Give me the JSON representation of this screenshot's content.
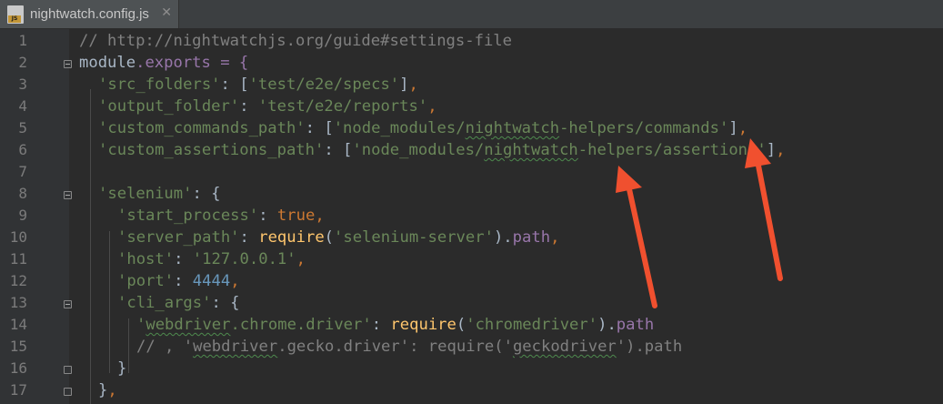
{
  "tab": {
    "icon_label": "JS",
    "filename": "nightwatch.config.js",
    "close": "✕"
  },
  "line_numbers": [
    "1",
    "2",
    "3",
    "4",
    "5",
    "6",
    "7",
    "8",
    "9",
    "10",
    "11",
    "12",
    "13",
    "14",
    "15",
    "16",
    "17"
  ],
  "code": {
    "l1": {
      "c": "// http://nightwatchjs.org/guide#settings-file"
    },
    "l2": {
      "a": "module",
      "b": ".exports = {"
    },
    "l3": {
      "a": "'src_folders'",
      "b": ": [",
      "c": "'test/e2e/specs'",
      "d": "]",
      "e": ","
    },
    "l4": {
      "a": "'output_folder'",
      "b": ": ",
      "c": "'test/e2e/reports'",
      "d": ","
    },
    "l5": {
      "a": "'custom_commands_path'",
      "b": ": [",
      "c1": "'node_modules/",
      "c2": "nightwatch",
      "c3": "-helpers/commands'",
      "d": "]",
      "e": ","
    },
    "l6": {
      "a": "'custom_assertions_path'",
      "b": ": [",
      "c1": "'node_modules/",
      "c2": "nightwatch",
      "c3": "-helpers/assertions'",
      "d": "]",
      "e": ","
    },
    "l8": {
      "a": "'selenium'",
      "b": ": {"
    },
    "l9": {
      "a": "'start_process'",
      "b": ": ",
      "c": "true",
      "d": ","
    },
    "l10": {
      "a": "'server_path'",
      "b": ": ",
      "c": "require",
      "d": "(",
      "e": "'selenium-server'",
      "f": ").",
      "g": "path",
      "h": ","
    },
    "l11": {
      "a": "'host'",
      "b": ": ",
      "c": "'127.0.0.1'",
      "d": ","
    },
    "l12": {
      "a": "'port'",
      "b": ": ",
      "c": "4444",
      "d": ","
    },
    "l13": {
      "a": "'cli_args'",
      "b": ": {"
    },
    "l14": {
      "a1": "'",
      "a2": "webdriver",
      "a3": ".chrome.driver'",
      "b": ": ",
      "c": "require",
      "d": "(",
      "e": "'chromedriver'",
      "f": ").",
      "g": "path"
    },
    "l15": {
      "a": "// , '",
      "b": "webdriver",
      "c": ".gecko.driver': require('",
      "d": "geckodriver",
      "e": "').path"
    },
    "l16": {
      "a": "}"
    },
    "l17": {
      "a": "}",
      "b": ","
    }
  },
  "colors": {
    "annotation_arrow": "#f0502f"
  }
}
